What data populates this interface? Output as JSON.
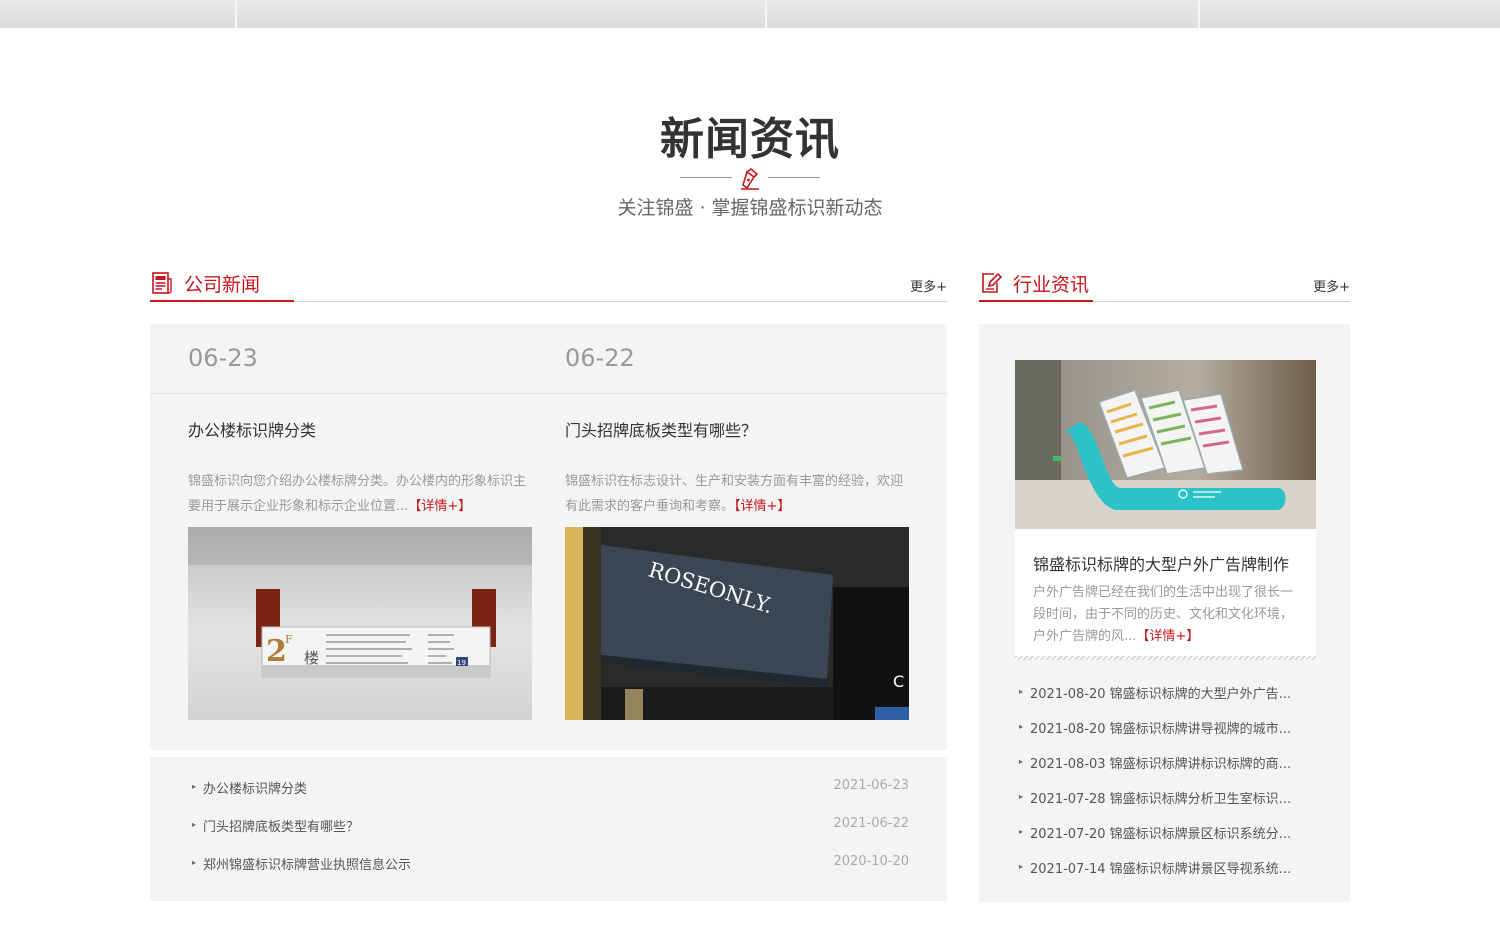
{
  "section": {
    "title": "新闻资讯",
    "subtitle": "关注锦盛 · 掌握锦盛标识新动态"
  },
  "company_news": {
    "heading": "公司新闻",
    "more": "更多+",
    "featured": [
      {
        "date": "06-23",
        "title": "办公楼标识牌分类",
        "desc": "锦盛标识向您介绍办公楼标牌分类。办公楼内的形象标识主要用于展示企业形象和标示企业位置...",
        "detail": "【详情+】",
        "image": {
          "sign_floor": "2",
          "sign_floor_sup": "F",
          "sign_label": "楼",
          "sign_number": "19"
        }
      },
      {
        "date": "06-22",
        "title": "门头招牌底板类型有哪些？",
        "desc": "锦盛标识在标志设计、生产和安装方面有丰富的经验，欢迎有此需求的客户垂询和考察。",
        "detail": "【详情+】",
        "image": {
          "sign_text": "ROSEONLY.",
          "side_text": "C"
        }
      }
    ],
    "list": [
      {
        "title": "办公楼标识牌分类",
        "date": "2021-06-23"
      },
      {
        "title": "门头招牌底板类型有哪些？",
        "date": "2021-06-22"
      },
      {
        "title": "郑州锦盛标识标牌营业执照信息公示",
        "date": "2020-10-20"
      }
    ]
  },
  "industry_news": {
    "heading": "行业资讯",
    "more": "更多+",
    "featured": {
      "title": "锦盛标识标牌的大型户外广告牌制作",
      "desc": "户外广告牌已经在我们的生活中出现了很长一段时间，由于不同的历史、文化和文化环境，户外广告牌的风...",
      "detail": "【详情+】"
    },
    "list": [
      "2021-08-20 锦盛标识标牌的大型户外广告...",
      "2021-08-20 锦盛标识标牌讲导视牌的城市...",
      "2021-08-03 锦盛标识标牌讲标识标牌的商...",
      "2021-07-28 锦盛标识标牌分析卫生室标识...",
      "2021-07-20 锦盛标识标牌景区标识系统分...",
      "2021-07-14 锦盛标识标牌讲景区导视系统..."
    ]
  },
  "colors": {
    "accent": "#c4161c",
    "panel": "#f4f4f4",
    "muted": "#999999"
  },
  "icons": {
    "deco": "pen-nib-icon",
    "company": "newspaper-icon",
    "industry": "edit-note-icon",
    "bullet": "triangle-right-icon"
  }
}
